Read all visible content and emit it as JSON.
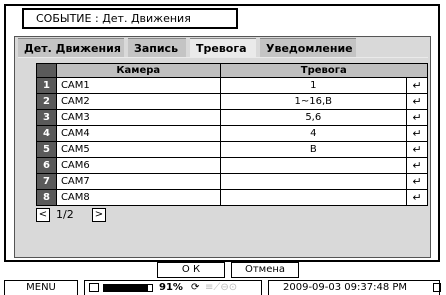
{
  "title": "СОБЫТИЕ : Дет. Движения",
  "tabs": [
    {
      "label": "Дет. Движения"
    },
    {
      "label": "Запись"
    },
    {
      "label": "Тревога"
    },
    {
      "label": "Уведомление"
    }
  ],
  "table": {
    "headers": {
      "camera": "Камера",
      "alarm": "Тревога"
    },
    "rows": [
      {
        "num": "1",
        "camera": "CAM1",
        "alarm": "1"
      },
      {
        "num": "2",
        "camera": "CAM2",
        "alarm": "1~16,B"
      },
      {
        "num": "3",
        "camera": "CAM3",
        "alarm": "5,6"
      },
      {
        "num": "4",
        "camera": "CAM4",
        "alarm": "4"
      },
      {
        "num": "5",
        "camera": "CAM5",
        "alarm": "B"
      },
      {
        "num": "6",
        "camera": "CAM6",
        "alarm": ""
      },
      {
        "num": "7",
        "camera": "CAM7",
        "alarm": ""
      },
      {
        "num": "8",
        "camera": "CAM8",
        "alarm": ""
      }
    ],
    "enter_glyph": "↵"
  },
  "pager": {
    "prev": "<",
    "page": "1/2",
    "next": ">"
  },
  "buttons": {
    "ok": "О К",
    "cancel": "Отмена"
  },
  "statusbar": {
    "menu": "MENU",
    "disk_percent": "91%",
    "disk_fill": 0.91,
    "datetime": "2009-09-03 09:37:48 PM"
  }
}
